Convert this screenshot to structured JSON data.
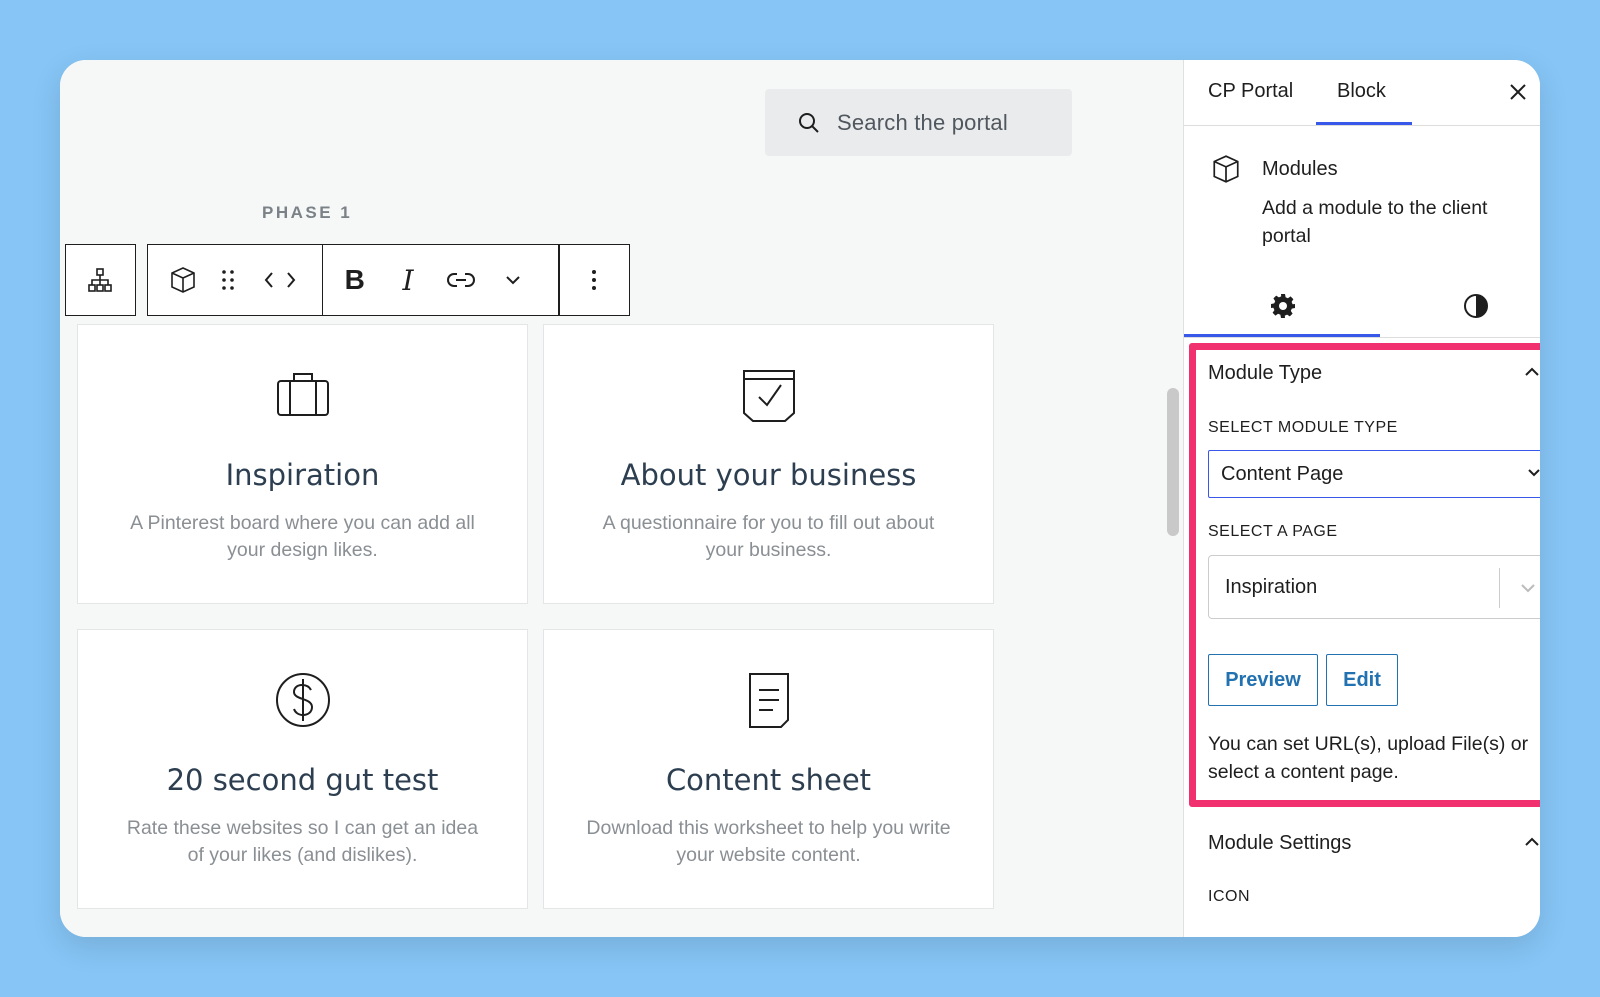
{
  "search": {
    "placeholder": "Search the portal",
    "icon": "search-icon"
  },
  "phase_label": "PHASE 1",
  "cards": [
    {
      "title": "Inspiration",
      "desc": "A Pinterest board where you can add all your design likes.",
      "icon": "briefcase-icon"
    },
    {
      "title": "About your business",
      "desc": "A questionnaire for you to fill out about your business.",
      "icon": "checklist-icon"
    },
    {
      "title": "20 second gut test",
      "desc": "Rate these websites so I can get an idea of your likes (and dislikes).",
      "icon": "dollar-icon"
    },
    {
      "title": "Content sheet",
      "desc": "Download this worksheet to help you write your website content.",
      "icon": "document-icon"
    }
  ],
  "sidebar": {
    "tabs": [
      "CP Portal",
      "Block"
    ],
    "active_tab": "Block",
    "block_title": "Modules",
    "block_desc": "Add a module to the client portal",
    "module_type": {
      "title": "Module Type",
      "select_label": "SELECT MODULE TYPE",
      "select_value": "Content Page",
      "page_label": "SELECT A PAGE",
      "page_value": "Inspiration",
      "preview_label": "Preview",
      "edit_label": "Edit",
      "help_text": "You can set URL(s), upload File(s) or select a content page."
    },
    "module_settings": {
      "title": "Module Settings",
      "icon_label": "ICON"
    }
  },
  "colors": {
    "accent": "#3858e9",
    "highlight": "#f0306f",
    "button": "#2271b1",
    "background": "#86c5f6"
  }
}
